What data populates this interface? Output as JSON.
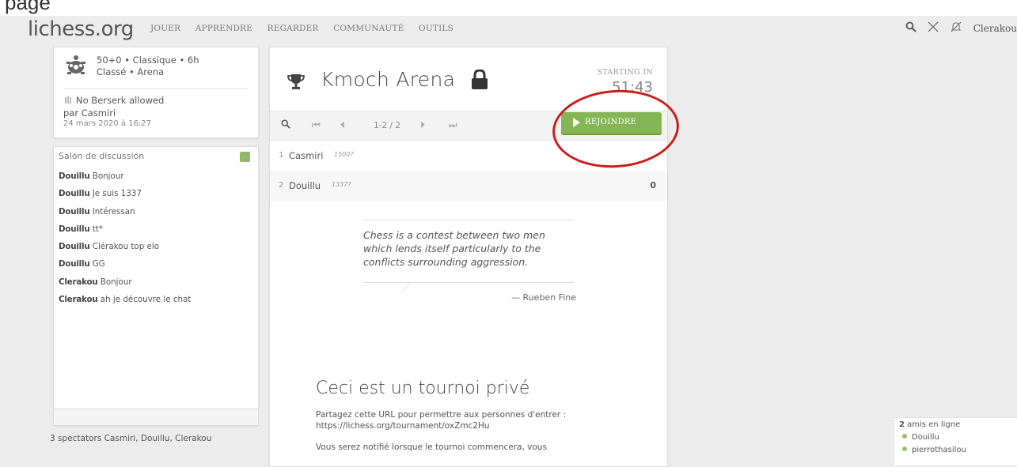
{
  "top_snippet": "page",
  "header": {
    "logo": "lichess.org",
    "nav": [
      "JOUER",
      "APPRENDRE",
      "REGARDER",
      "COMMUNAUTÉ",
      "OUTILS"
    ],
    "username": "Clerakou",
    "icons": [
      "search-icon",
      "swords-icon",
      "muted-bell-icon"
    ]
  },
  "tournament_info": {
    "line1": "50+0 • Classique • 6h",
    "line2": "Classé • Arena",
    "berserk": "No Berserk allowed",
    "by": "par Casmiri",
    "date": "24 mars 2020 à 16:27"
  },
  "chat": {
    "title": "Salon de discussion",
    "messages": [
      {
        "user": "Douillu",
        "text": "Bonjour"
      },
      {
        "user": "Douillu",
        "text": "Je suis 1337"
      },
      {
        "user": "Douillu",
        "text": "Intéressan"
      },
      {
        "user": "Douillu",
        "text": "tt*"
      },
      {
        "user": "Douillu",
        "text": "Clérakou top elo"
      },
      {
        "user": "Douillu",
        "text": "GG"
      },
      {
        "user": "Clerakou",
        "text": "Bonjour"
      },
      {
        "user": "Clerakou",
        "text": "ah je découvre le chat"
      }
    ]
  },
  "spectators": "3 spectators Casmiri, Douillu, Clerakou",
  "tournament": {
    "name": "Kmoch Arena",
    "starting_label": "STARTING IN",
    "countdown": "51:43",
    "page_count": "1-2 / 2",
    "join_label": "REJOINDRE",
    "players": [
      {
        "rank": "1",
        "name": "Casmiri",
        "rating": "1500?",
        "score": ""
      },
      {
        "rank": "2",
        "name": "Douillu",
        "rating": "1337?",
        "score": "0"
      }
    ],
    "quote_lines": [
      "Chess is a contest between two men",
      "which lends itself particularly to the",
      "conflicts surrounding aggression."
    ],
    "quote_author": "— Rueben Fine",
    "private_title": "Ceci est un tournoi privé",
    "private_line1": "Partagez cette URL pour permettre aux personnes d'entrer :",
    "private_url": "https://lichess.org/tournament/oxZmc2Hu",
    "private_line3": "Vous serez notifié lorsque le tournoi commencera, vous"
  },
  "friends": {
    "count": "2",
    "label": "amis en ligne",
    "list": [
      "Douillu",
      "pierrothasilou"
    ]
  },
  "colors": {
    "join_green": "#86b555",
    "annotation_red": "#cc1d1d",
    "chat_toggle": "#8fb86b"
  }
}
